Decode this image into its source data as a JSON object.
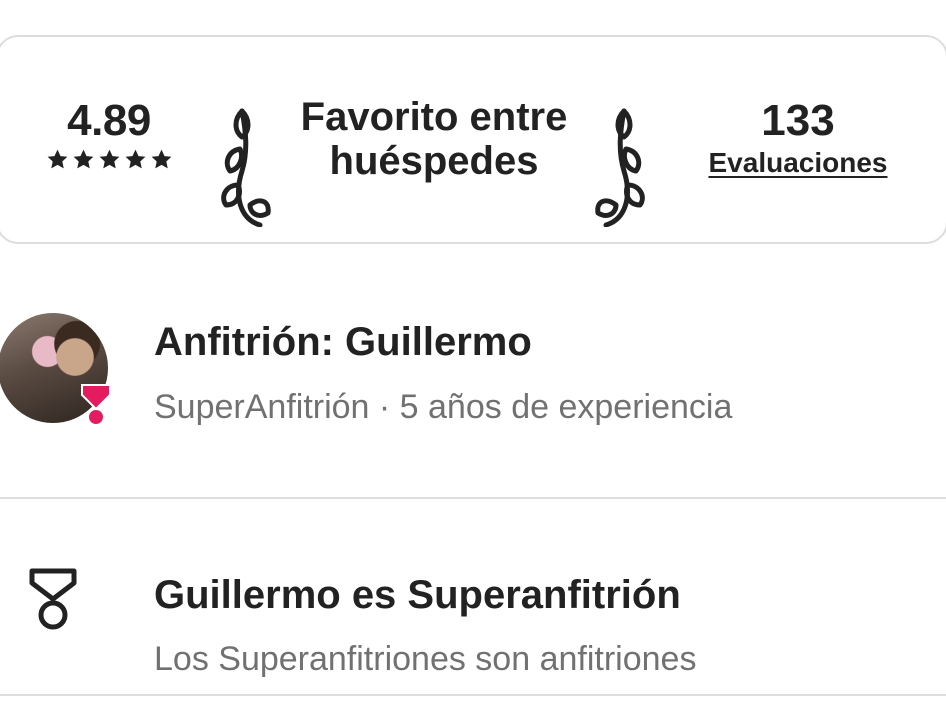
{
  "rating_card": {
    "rating_value": "4.89",
    "stars_filled": 5,
    "favorite_title": "Favorito entre huéspedes",
    "reviews_count": "133",
    "reviews_link": "Evaluaciones"
  },
  "host": {
    "name_line": "Anfitrión: Guillermo",
    "meta_line": "SuperAnfitrión · 5  años de experiencia",
    "badge_color": "#e31c5f"
  },
  "superhost": {
    "icon": "medal-icon",
    "title": "Guillermo es Superanfitrión",
    "description": "Los Superanfitriones son anfitriones"
  }
}
